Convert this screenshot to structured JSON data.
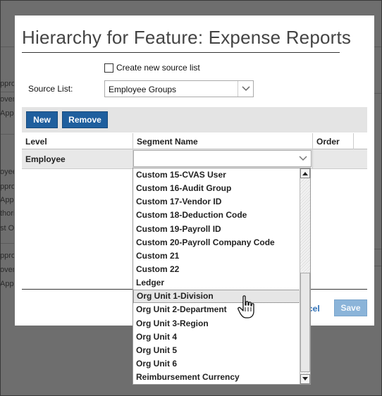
{
  "background": {
    "left_fragments": [
      "ppro",
      "over",
      "Appr",
      "oyee",
      "ppro",
      "Appr",
      "thori",
      "st O",
      "ppro",
      "over",
      "Appr"
    ]
  },
  "dialog": {
    "title": "Hierarchy for Feature: Expense Reports",
    "create_new_label": "Create new source list",
    "source_list_label": "Source List:",
    "source_list_value": "Employee Groups",
    "new_button": "New",
    "remove_button": "Remove",
    "columns": {
      "level": "Level",
      "segment_name": "Segment Name",
      "order": "Order"
    },
    "row": {
      "level": "Employee",
      "segment_value": ""
    },
    "cancel_label": "cel",
    "save_label": "Save"
  },
  "dropdown": {
    "options": [
      "Custom 15-CVAS User",
      "Custom 16-Audit Group",
      "Custom 17-Vendor ID",
      "Custom 18-Deduction Code",
      "Custom 19-Payroll ID",
      "Custom 20-Payroll Company Code",
      "Custom 21",
      "Custom 22",
      "Ledger",
      "Org Unit 1-Division",
      "Org Unit 2-Department",
      "Org Unit 3-Region",
      "Org Unit 4",
      "Org Unit 5",
      "Org Unit 6",
      "Reimbursement Currency"
    ],
    "highlighted": "Org Unit 1-Division"
  },
  "colors": {
    "primary_button": "#1f5f9e",
    "disabled_button": "#8bb4d9",
    "link": "#2a6db5"
  },
  "icons": [
    "chevron-down-icon",
    "scroll-up-icon",
    "scroll-down-icon",
    "hand-pointer-icon"
  ]
}
